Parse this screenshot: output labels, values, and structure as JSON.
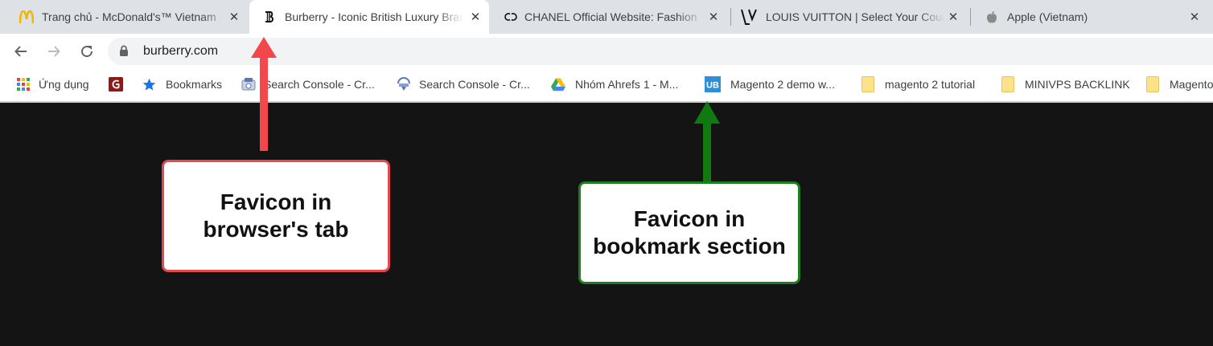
{
  "tabs": [
    {
      "title": "Trang chủ - McDonald's™ Vietnam",
      "favicon": "mcdonalds-logo-icon",
      "active": false
    },
    {
      "title": "Burberry - Iconic British Luxury Brand",
      "favicon": "burberry-logo-icon",
      "active": true
    },
    {
      "title": "CHANEL Official Website: Fashion",
      "favicon": "chanel-logo-icon",
      "active": false
    },
    {
      "title": "LOUIS VUITTON | Select Your Country",
      "favicon": "louis-vuitton-logo-icon",
      "active": false
    },
    {
      "title": "Apple (Vietnam)",
      "favicon": "apple-logo-icon",
      "active": false
    }
  ],
  "toolbar": {
    "back_icon": "arrow-left-icon",
    "forward_icon": "arrow-right-icon",
    "reload_icon": "reload-icon",
    "url": "burberry.com"
  },
  "bookmarks": [
    {
      "label": "Ứng dụng",
      "icon": "apps-grid-icon"
    },
    {
      "label": "",
      "icon": "red-extension-icon"
    },
    {
      "label": "Bookmarks",
      "icon": "star-icon"
    },
    {
      "label": "Search Console - Cr...",
      "icon": "search-console-icon"
    },
    {
      "label": "Search Console - Cr...",
      "icon": "search-console-icon"
    },
    {
      "label": "Nhóm Ahrefs 1 - M...",
      "icon": "google-drive-icon"
    },
    {
      "label": "Magento 2 demo w...",
      "icon": "ub-logo-icon"
    },
    {
      "label": "magento 2 tutorial",
      "icon": "folder-icon"
    },
    {
      "label": "MINIVPS BACKLINK",
      "icon": "folder-icon"
    },
    {
      "label": "Magento",
      "icon": "folder-icon"
    }
  ],
  "annotations": {
    "tab_callout": {
      "line1": "Favicon in",
      "line2": "browser's tab"
    },
    "bookmark_callout": {
      "line1": "Favicon in",
      "line2": "bookmark section"
    }
  },
  "colors": {
    "tab_callout_border": "#e5484d",
    "bookmark_callout_border": "#1e7d1e",
    "page_background": "#141414",
    "tab_strip": "#dee1e6"
  },
  "ub_logo_text": "UB"
}
